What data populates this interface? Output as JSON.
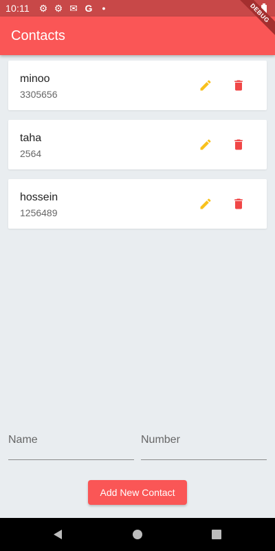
{
  "status_bar": {
    "time": "10:11"
  },
  "app_bar": {
    "title": "Contacts",
    "debug_label": "DEBUG"
  },
  "contacts": [
    {
      "name": "minoo",
      "number": "3305656"
    },
    {
      "name": "taha",
      "number": "2564"
    },
    {
      "name": "hossein",
      "number": "1256489"
    }
  ],
  "form": {
    "name_placeholder": "Name",
    "number_placeholder": "Number",
    "name_value": "",
    "number_value": ""
  },
  "actions": {
    "add_label": "Add New Contact"
  },
  "colors": {
    "accent": "#fa5656",
    "edit": "#f8c11d",
    "delete": "#f04747"
  }
}
